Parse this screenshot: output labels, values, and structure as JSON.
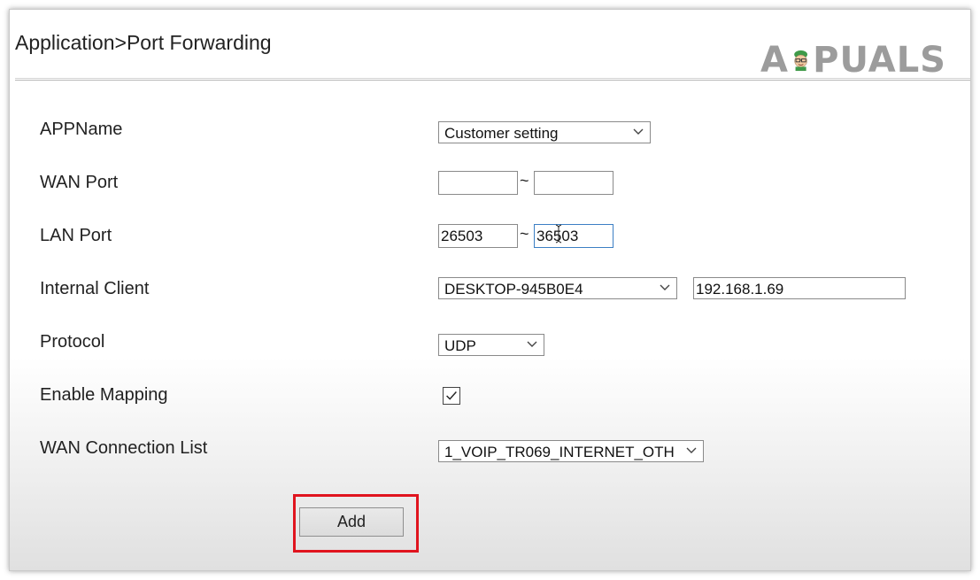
{
  "header": {
    "title": "Application>Port Forwarding",
    "logo_text": "APPUALS"
  },
  "form": {
    "appname": {
      "label": "APPName",
      "value": "Customer setting"
    },
    "wan_port": {
      "label": "WAN Port",
      "start": "",
      "end": "",
      "separator": "~"
    },
    "lan_port": {
      "label": "LAN Port",
      "start": "26503",
      "end": "36503",
      "separator": "~"
    },
    "internal_client": {
      "label": "Internal Client",
      "device": "DESKTOP-945B0E4",
      "ip": "192.168.1.69"
    },
    "protocol": {
      "label": "Protocol",
      "value": "UDP"
    },
    "enable_mapping": {
      "label": "Enable Mapping",
      "checked": true
    },
    "wan_connection_list": {
      "label": "WAN Connection List",
      "value": "1_VOIP_TR069_INTERNET_OTH"
    }
  },
  "actions": {
    "add_label": "Add"
  },
  "colors": {
    "highlight": "#e0141e",
    "focus_border": "#3c7fc4",
    "logo": "#9c9c9c"
  },
  "icons": [
    "chevron-down-icon",
    "checkmark-icon",
    "text-cursor-icon",
    "appuals-mascot-icon"
  ]
}
